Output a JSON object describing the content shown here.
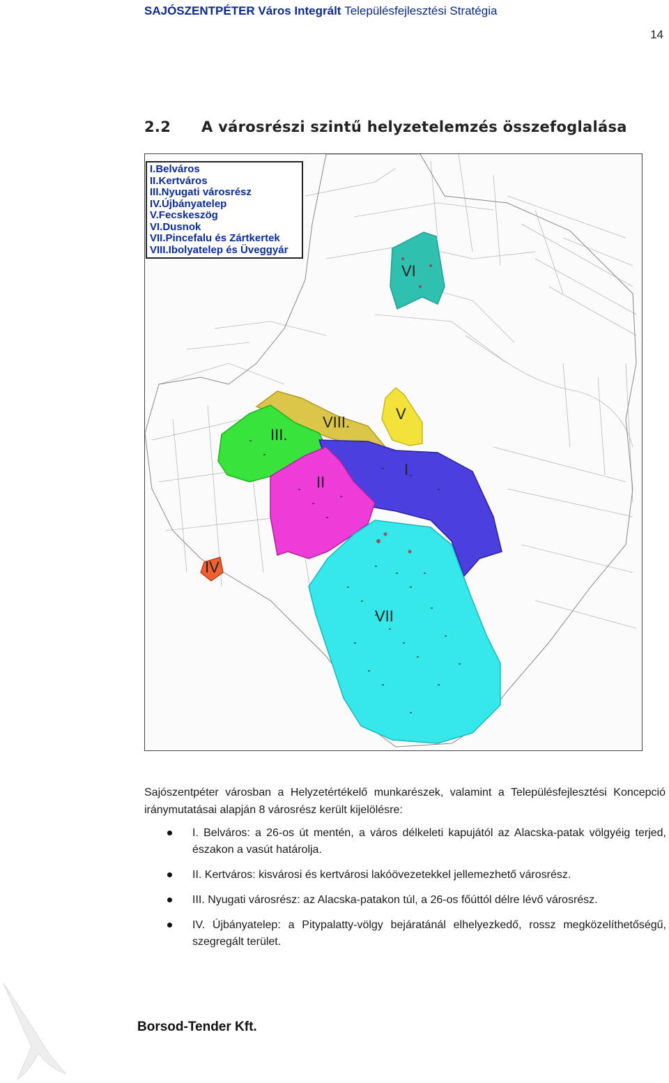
{
  "header": {
    "bold_part": "SAJÓSZENTPÉTER Város Integrált ",
    "light_part": "Településfejlesztési Stratégia"
  },
  "page_number": "14",
  "section": {
    "number": "2.2",
    "title": "A városrészi szintű helyzetelemzés összefoglalása"
  },
  "map": {
    "legend": [
      "I.Belváros",
      "II.Kertváros",
      "III.Nyugati városrész",
      "IV.Újbányatelep",
      "V.Fecskeszög",
      "VI.Dusnok",
      "VII.Pincefalu és Zártkertek",
      "VIII.Ibolyatelep és Üveggyár"
    ],
    "district_labels": {
      "I": "I",
      "II": "II",
      "III": "III.",
      "IV": "IV",
      "V": "V",
      "VI": "VI",
      "VII": "VII",
      "VIII": "VIII."
    },
    "colors": {
      "I": "#4b3fe0",
      "II": "#ee3cd8",
      "III": "#38e43c",
      "IV": "#f06030",
      "V": "#f2e23a",
      "VI": "#30c0b0",
      "VII": "#36e8ea",
      "VIII": "#dcc64a"
    }
  },
  "intro": "Sajószentpéter városban a Helyzetértékelő munkarészek, valamint a Településfejlesztési Koncepció iránymutatásai alapján 8 városrész került kijelölésre:",
  "bullets": [
    "I. Belváros: a 26-os út mentén, a város délkeleti kapujától az Alacska-patak völgyéig terjed, északon a vasút határolja.",
    "II. Kertváros: kisvárosi és kertvárosi lakóövezetekkel jellemezhető városrész.",
    "III. Nyugati városrész: az Alacska-patakon túl, a 26-os főúttól délre lévő városrész.",
    "IV. Újbányatelep: a Pitypalatty-völgy bejáratánál elhelyezkedő, rossz megközelíthetőségű, szegregált terület."
  ],
  "footer": "Borsod-Tender Kft."
}
